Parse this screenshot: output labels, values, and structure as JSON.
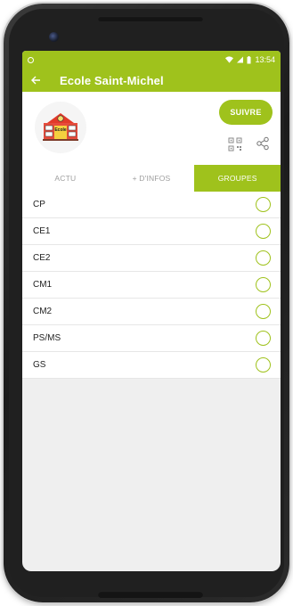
{
  "status_bar": {
    "time": "13:54"
  },
  "app_bar": {
    "title": "Ecole Saint-Michel"
  },
  "header": {
    "follow_label": "SUIVRE",
    "logo_text": "Ecole"
  },
  "tabs": [
    {
      "label": "ACTU",
      "active": false
    },
    {
      "label": "+ D'INFOS",
      "active": false
    },
    {
      "label": "GROUPES",
      "active": true
    }
  ],
  "groups": [
    {
      "label": "CP"
    },
    {
      "label": "CE1"
    },
    {
      "label": "CE2"
    },
    {
      "label": "CM1"
    },
    {
      "label": "CM2"
    },
    {
      "label": "PS/MS"
    },
    {
      "label": "GS"
    }
  ],
  "colors": {
    "accent": "#9fc21c",
    "screen_bg": "#efefef"
  }
}
